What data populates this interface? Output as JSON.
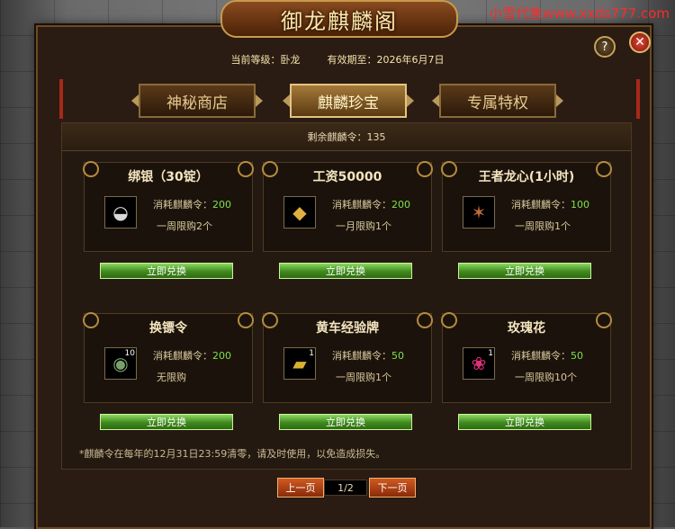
{
  "watermark": "小雪代售www.xxds777.com",
  "window": {
    "title": "御龙麒麟阁",
    "help_label": "?",
    "close_label": "✕"
  },
  "info": {
    "level": "当前等级：卧龙",
    "expiry": "有效期至：2026年6月7日"
  },
  "tabs": [
    {
      "label": "神秘商店",
      "active": false
    },
    {
      "label": "麒麟珍宝",
      "active": true
    },
    {
      "label": "专属特权",
      "active": false
    }
  ],
  "remaining": "剩余麒麟令：135",
  "cost_prefix": "消耗麒麟令：",
  "items": [
    {
      "name": "绑银（30锭）",
      "cost": "200",
      "limit": "一周限购2个",
      "count": "",
      "icon": "silver-ingot-icon",
      "button": "立即兑换"
    },
    {
      "name": "工资50000",
      "cost": "200",
      "limit": "一月限购1个",
      "count": "",
      "icon": "gold-pouch-icon",
      "button": "立即兑换"
    },
    {
      "name": "王者龙心(1小时)",
      "cost": "100",
      "limit": "一周限购1个",
      "count": "",
      "icon": "dragon-heart-icon",
      "button": "立即兑换"
    },
    {
      "name": "换镖令",
      "cost": "200",
      "limit": "无限购",
      "count": "10",
      "icon": "jade-token-icon",
      "button": "立即兑换"
    },
    {
      "name": "黄车经验牌",
      "cost": "50",
      "limit": "一周限购1个",
      "count": "1",
      "icon": "yellow-cart-icon",
      "button": "立即兑换"
    },
    {
      "name": "玫瑰花",
      "cost": "50",
      "limit": "一周限购10个",
      "count": "1",
      "icon": "rose-icon",
      "button": "立即兑换"
    }
  ],
  "note": "*麒麟令在每年的12月31日23:59清零，请及时使用，以免造成损失。",
  "pager": {
    "prev": "上一页",
    "page": "1/2",
    "next": "下一页"
  }
}
